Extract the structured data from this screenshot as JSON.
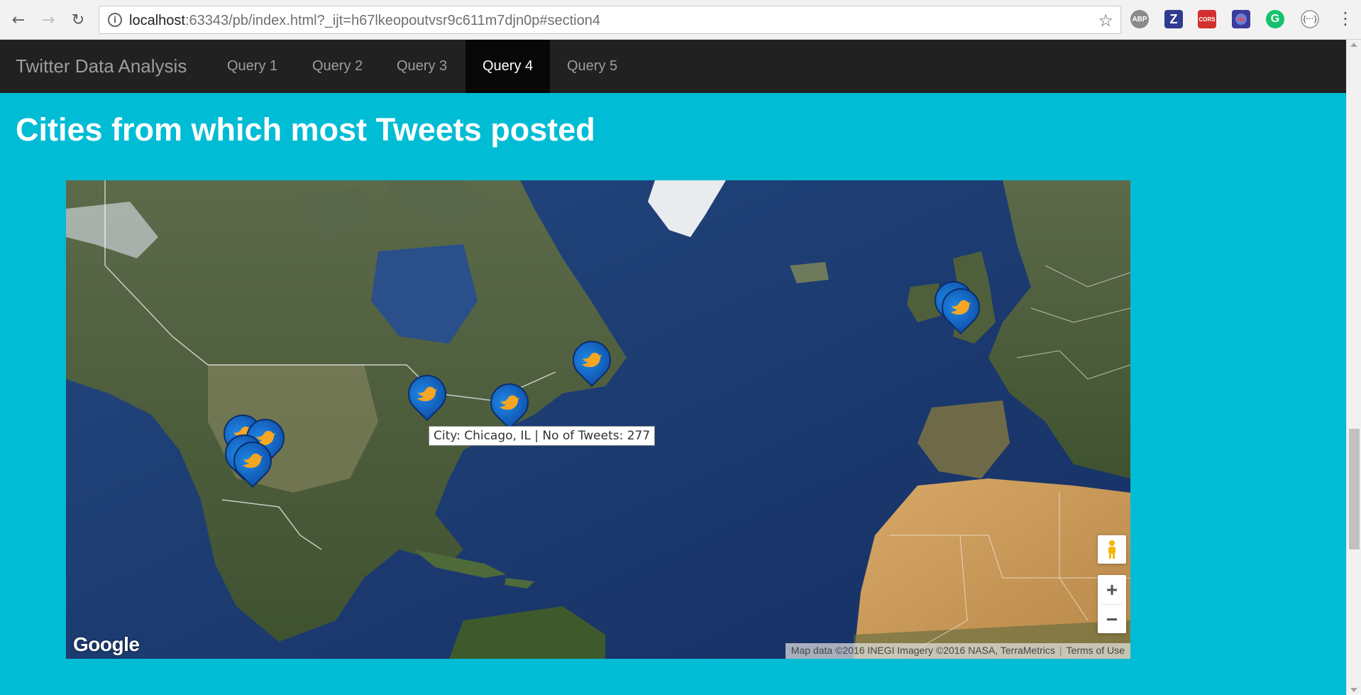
{
  "browser": {
    "url_host": "localhost",
    "url_rest": ":63343/pb/index.html?_ijt=h67lkeopoutvsr9c611m7djn0p#section4",
    "extensions": [
      "ABP",
      "Z",
      "CORS",
      "G",
      "{···}"
    ]
  },
  "navbar": {
    "brand": "Twitter Data Analysis",
    "items": [
      {
        "label": "Query 1",
        "active": false
      },
      {
        "label": "Query 2",
        "active": false
      },
      {
        "label": "Query 3",
        "active": false
      },
      {
        "label": "Query 4",
        "active": true
      },
      {
        "label": "Query 5",
        "active": false
      }
    ]
  },
  "section": {
    "title": "Cities from which most Tweets posted"
  },
  "map": {
    "tooltip": "City: Chicago, IL | No of Tweets: 277",
    "logo": "Google",
    "attribution": "Map data ©2016 INEGI Imagery ©2016 NASA, TerraMetrics",
    "terms": "Terms of Use",
    "zoom_in": "+",
    "zoom_out": "−",
    "marker_icon": "twitter-bird-icon",
    "colors": {
      "ocean": "#1d3f7a",
      "land": "#4c5e3a",
      "desert": "#c49a5c",
      "ice": "#e8ecef",
      "marker": "#1565c0"
    }
  }
}
